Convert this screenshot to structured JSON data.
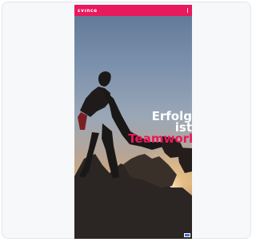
{
  "app": {
    "brand": "ɛvınce"
  },
  "hero": {
    "line1": "Erfolg",
    "line2": "ist",
    "line3": "Teamwork"
  },
  "icons": {
    "menu": "more-icon",
    "badge": "corner-badge-icon"
  },
  "colors": {
    "accent": "#e8195c",
    "text": "#ffffff"
  }
}
